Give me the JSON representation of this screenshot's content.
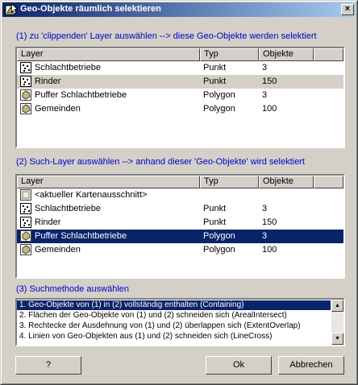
{
  "window": {
    "title": "Geo-Objekte räumlich selektieren",
    "close_glyph": "×"
  },
  "section1": {
    "label": "(1) zu 'clippenden' Layer auswählen --> diese Geo-Objekte werden selektiert",
    "columns": [
      "Layer",
      "Typ",
      "Objekte"
    ],
    "rows": [
      {
        "icon": "point-layer-icon",
        "layer": "Schlachtbetriebe",
        "typ": "Punkt",
        "objekte": "3"
      },
      {
        "icon": "point-layer-icon",
        "layer": "Rinder",
        "typ": "Punkt",
        "objekte": "150"
      },
      {
        "icon": "polygon-layer-icon",
        "layer": "Puffer Schlachtbetriebe",
        "typ": "Polygon",
        "objekte": "3"
      },
      {
        "icon": "polygon-layer-icon",
        "layer": "Gemeinden",
        "typ": "Polygon",
        "objekte": "100"
      }
    ],
    "selected_index": 1
  },
  "section2": {
    "label": "(2) Such-Layer auswählen --> anhand dieser 'Geo-Objekte' wird selektiert",
    "columns": [
      "Layer",
      "Typ",
      "Objekte"
    ],
    "rows": [
      {
        "icon": "map-extent-icon",
        "layer": "<aktueller Kartenausschnitt>",
        "typ": "",
        "objekte": ""
      },
      {
        "icon": "point-layer-icon",
        "layer": "Schlachtbetriebe",
        "typ": "Punkt",
        "objekte": "3"
      },
      {
        "icon": "point-layer-icon",
        "layer": "Rinder",
        "typ": "Punkt",
        "objekte": "150"
      },
      {
        "icon": "polygon-layer-icon",
        "layer": "Puffer Schlachtbetriebe",
        "typ": "Polygon",
        "objekte": "3"
      },
      {
        "icon": "polygon-layer-icon",
        "layer": "Gemeinden",
        "typ": "Polygon",
        "objekte": "100"
      }
    ],
    "selected_index": 3
  },
  "section3": {
    "label": "(3) Suchmethode auswählen",
    "methods": [
      "1. Geo-Objekte von (1) in (2) vollständig enthalten (Containing)",
      "2. Flächen der Geo-Objekte von (1) und (2) schneiden sich (ArealIntersect)",
      "3. Rechtecke der Ausdehnung von (1) und (2) überlappen sich (ExtentOverlap)",
      "4. Linien von Geo-Objekten aus (1) und (2) schneiden sich (LineCross)"
    ],
    "selected_index": 0,
    "scroll_up_glyph": "▲",
    "scroll_down_glyph": "▼"
  },
  "buttons": {
    "help": "?",
    "ok": "Ok",
    "cancel": "Abbrechen"
  },
  "colors": {
    "title_start": "#0a246a",
    "title_end": "#a6caf0",
    "section_label": "#0000c8",
    "selection": "#0a246a",
    "face": "#d4d0c8"
  }
}
